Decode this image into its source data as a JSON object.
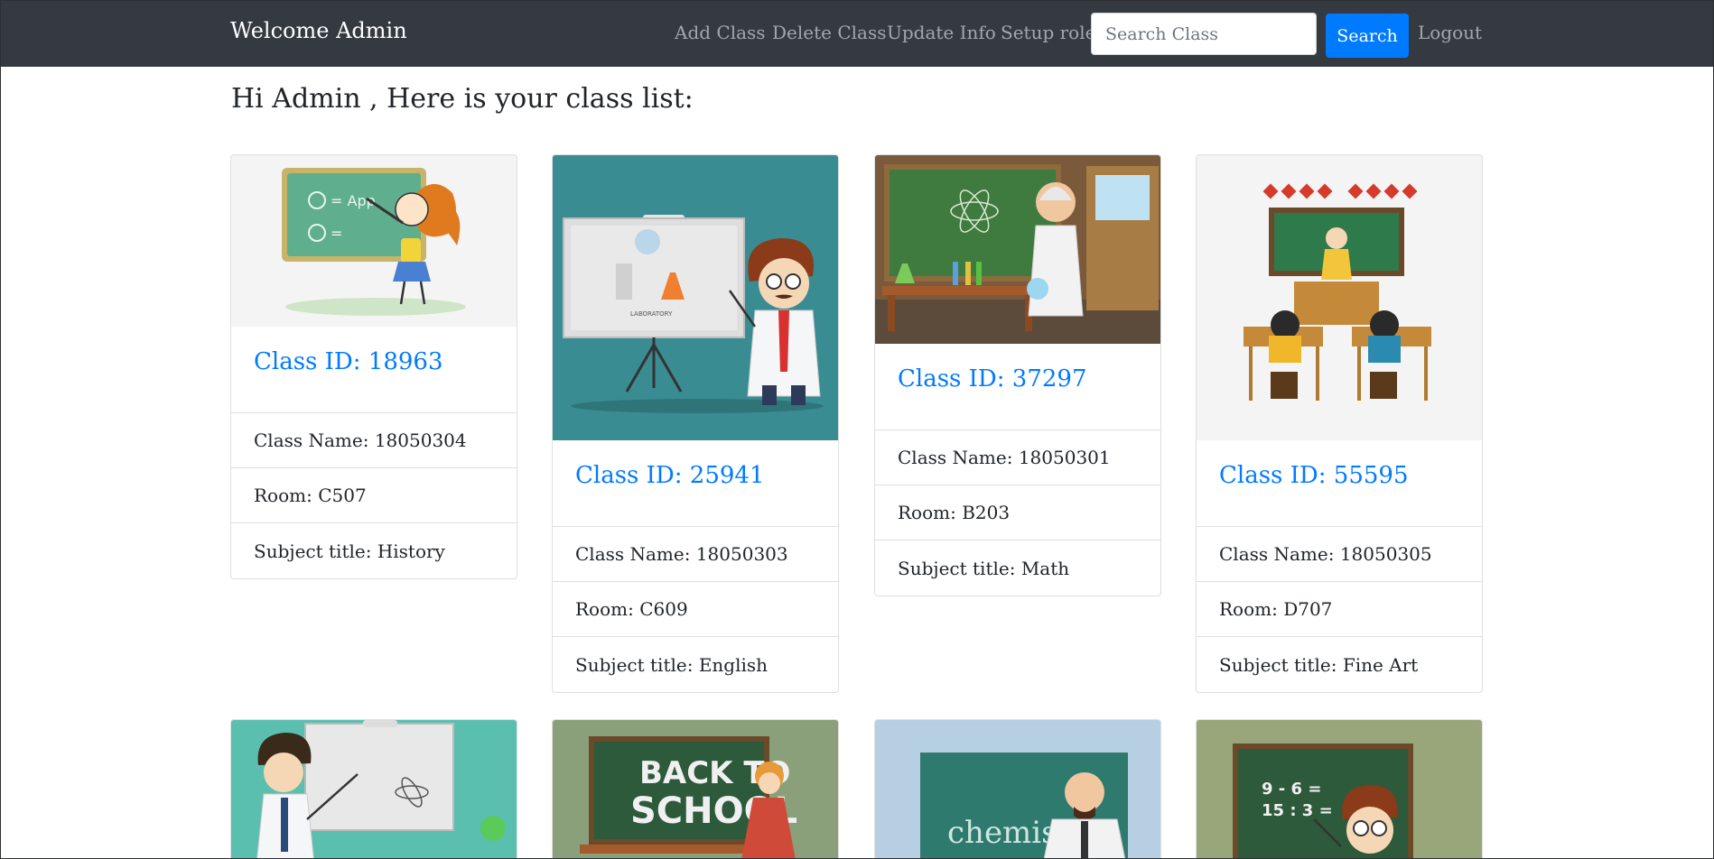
{
  "nav": {
    "brand": "Welcome Admin",
    "links": [
      "Add Class",
      "Delete Class",
      "Update Info",
      "Setup role"
    ],
    "search_placeholder": "Search Class",
    "search_button": "Search",
    "logout": "Logout"
  },
  "heading": "Hi Admin , Here is your class list:",
  "classes": [
    {
      "title": "Class ID: 18963",
      "name": "Class Name: 18050304",
      "room": "Room: C507",
      "subject": "Subject title: History"
    },
    {
      "title": "Class ID: 25941",
      "name": "Class Name: 18050303",
      "room": "Room: C609",
      "subject": "Subject title: English"
    },
    {
      "title": "Class ID: 37297",
      "name": "Class Name: 18050301",
      "room": "Room: B203",
      "subject": "Subject title: Math"
    },
    {
      "title": "Class ID: 55595",
      "name": "Class Name: 18050305",
      "room": "Room: D707",
      "subject": "Subject title: Fine Art"
    }
  ],
  "image_text": {
    "back_to_school_1": "BACK TO",
    "back_to_school_2": "SCHOOL",
    "chemistry": "chemistry",
    "math_1": "9 - 6 =",
    "math_2": "15 : 3 =",
    "lab": "LABORATORY"
  },
  "colors": {
    "navbar": "#343a40",
    "link": "#007bff",
    "search_button": "#007bff"
  }
}
